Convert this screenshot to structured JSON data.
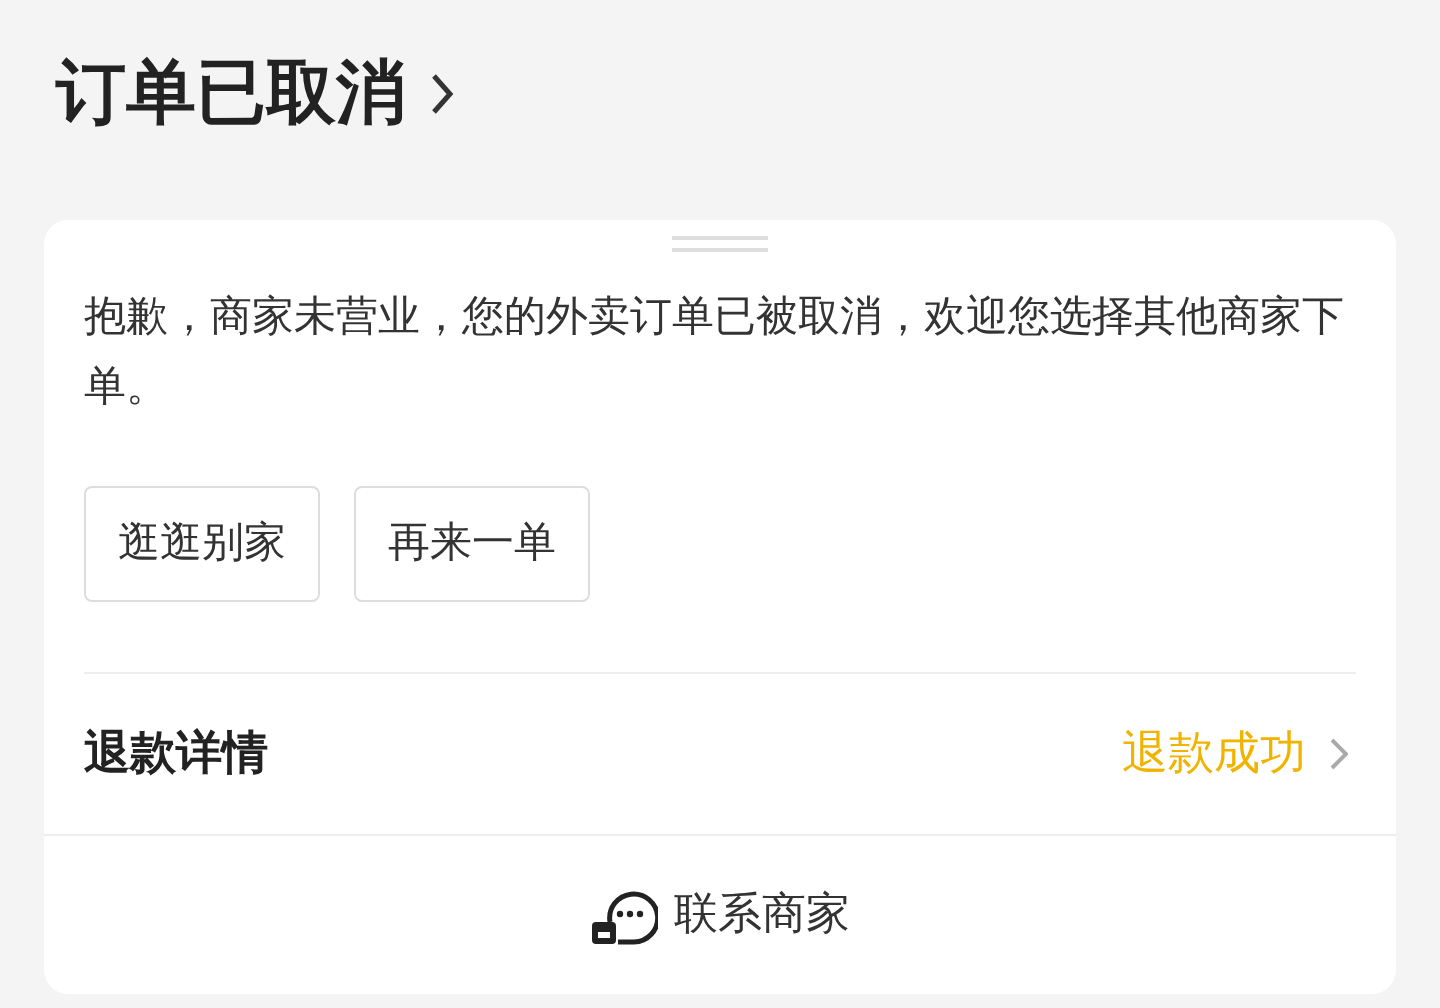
{
  "header": {
    "title": "订单已取消"
  },
  "notice": {
    "message": "抱歉，商家未营业，您的外卖订单已被取消，欢迎您选择其他商家下单。"
  },
  "buttons": [
    {
      "label": "逛逛别家"
    },
    {
      "label": "再来一单"
    }
  ],
  "refund": {
    "label": "退款详情",
    "status": "退款成功"
  },
  "contact": {
    "label": "联系商家"
  }
}
